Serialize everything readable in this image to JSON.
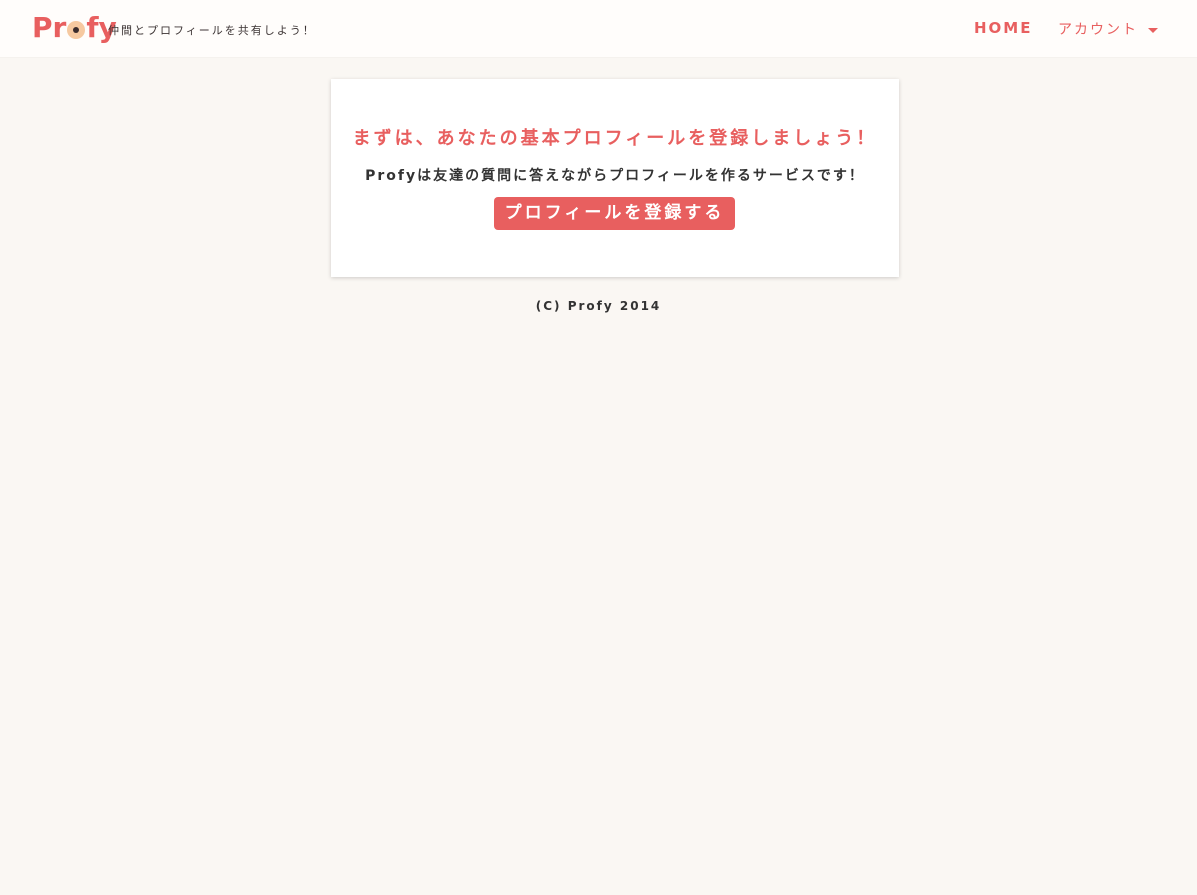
{
  "header": {
    "logo_prefix": "Pr",
    "logo_suffix": "fy",
    "tagline": "仲間とプロフィールを共有しよう！",
    "nav_home": "HOME",
    "nav_account": "アカウント"
  },
  "card": {
    "heading": "まずは、あなたの基本プロフィールを登録しましょう！",
    "description": "Profyは友達の質問に答えながらプロフィールを作るサービスです！",
    "button_label": "プロフィールを登録する"
  },
  "footer": {
    "copyright": "(C) Profy 2014"
  },
  "colors": {
    "accent": "#e85f5f",
    "background": "#faf7f3",
    "text": "#333333"
  },
  "icons": {
    "logo_eye": "eye-icon",
    "dropdown": "caret-down-icon"
  }
}
